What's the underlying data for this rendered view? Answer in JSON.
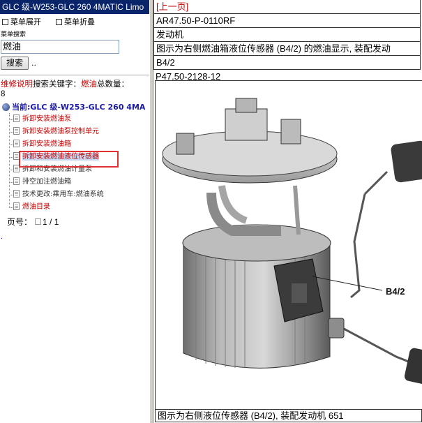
{
  "left": {
    "window_title": "GLC 级-W253-GLC 260 4MATIC Limo",
    "menu_expand": "菜单展开",
    "menu_collapse": "菜单折叠",
    "search_label": "菜单搜索",
    "search_value": "燃油",
    "search_button": "搜索",
    "search_dots": "..",
    "info_prefix": "维修说明",
    "info_mid": "搜索关键字：",
    "info_keyword": "燃油",
    "info_total": "总数量：",
    "info_count": "8",
    "root_label": "当前:GLC 级-W253-GLC 260 4MA",
    "tree_items": [
      {
        "label": "拆卸安装燃油泵",
        "color": "#c00000"
      },
      {
        "label": "拆卸安装燃油泵控制单元",
        "color": "#c00000"
      },
      {
        "label": "拆卸安装燃油箱",
        "color": "#c00000"
      },
      {
        "label": "拆卸安装燃油液位传感器",
        "color": "#c00000"
      },
      {
        "label": "拆卸和安装燃油计量泵",
        "color": "#333333"
      },
      {
        "label": "排空加注燃油箱",
        "color": "#333333"
      },
      {
        "label": "技术更改:乘用车:燃油系统",
        "color": "#333333"
      },
      {
        "label": "燃油目录",
        "color": "#c00000"
      }
    ],
    "pager_label": "页号：",
    "pager_value": "1 / 1",
    "bottom_mark": "."
  },
  "right": {
    "prev_link": "[上一页]",
    "doc_code": "AR47.50-P-0110RF",
    "category": "发动机",
    "description": "图示为右侧燃油箱液位传感器 (B4/2) 的燃油显示, 装配发动",
    "component": "B4/2",
    "image_code": "P47.50-2128-12",
    "figure_callout": "B4/2",
    "caption": "图示为右侧液位传感器 (B4/2), 装配发动机 651"
  },
  "colors": {
    "title_bg": "#0a246a",
    "link_red": "#c00000",
    "root_blue": "#1a1aa6",
    "highlight_box": "#e03030"
  }
}
